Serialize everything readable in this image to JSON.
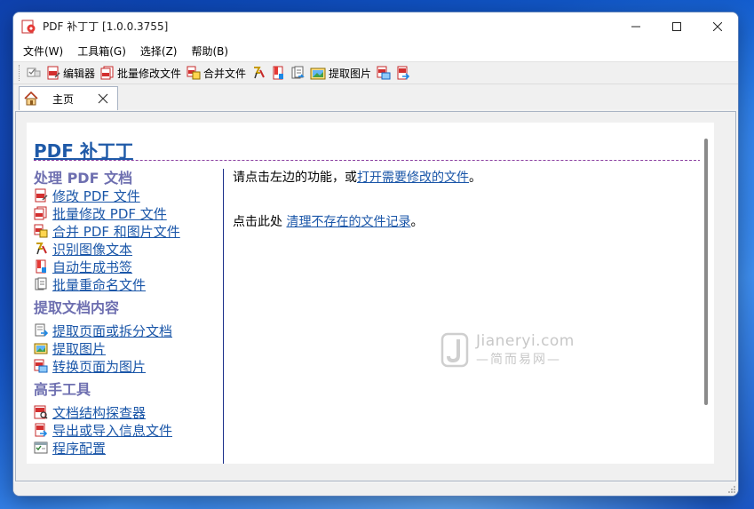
{
  "window": {
    "title": "PDF 补丁丁 [1.0.0.3755]"
  },
  "menu": {
    "items": [
      "文件(W)",
      "工具箱(G)",
      "选择(Z)",
      "帮助(B)"
    ]
  },
  "toolbar": {
    "editor_label": "编辑器",
    "batch_label": "批量修改文件",
    "merge_label": "合并文件",
    "extract_images_label": "提取图片"
  },
  "tab": {
    "label": "主页"
  },
  "page": {
    "title": "PDF 补丁丁",
    "sections": [
      {
        "heading": "处理 PDF 文档",
        "links": [
          {
            "label": "修改 PDF 文件",
            "icon": "pdf-edit-icon"
          },
          {
            "label": "批量修改 PDF 文件",
            "icon": "pdf-batch-icon"
          },
          {
            "label": "合并 PDF 和图片文件",
            "icon": "pdf-merge-icon"
          },
          {
            "label": "识别图像文本",
            "icon": "ocr-icon"
          },
          {
            "label": "自动生成书签",
            "icon": "bookmark-icon"
          },
          {
            "label": "批量重命名文件",
            "icon": "rename-icon"
          }
        ]
      },
      {
        "heading": "提取文档内容",
        "links": [
          {
            "label": "提取页面或拆分文档",
            "icon": "extract-pages-icon"
          },
          {
            "label": "提取图片",
            "icon": "extract-images-icon"
          },
          {
            "label": "转换页面为图片",
            "icon": "page-to-image-icon"
          }
        ]
      },
      {
        "heading": "高手工具",
        "links": [
          {
            "label": "文档结构探查器",
            "icon": "structure-inspector-icon"
          },
          {
            "label": "导出或导入信息文件",
            "icon": "export-import-icon"
          },
          {
            "label": "程序配置",
            "icon": "settings-icon"
          }
        ]
      }
    ],
    "right": {
      "line1_prefix": "请点击左边的功能，或",
      "line1_link": "打开需要修改的文件",
      "line1_suffix": "。",
      "line2_prefix": "点击此处 ",
      "line2_link": "清理不存在的文件记录",
      "line2_suffix": "。"
    }
  },
  "watermark": {
    "top": "Jianeryi.com",
    "bottom": "—简而易网—"
  },
  "colors": {
    "link": "#1a56a8",
    "heading": "#6e6fb0",
    "title": "#1f5aa8",
    "pdf_red": "#d32f2f"
  }
}
